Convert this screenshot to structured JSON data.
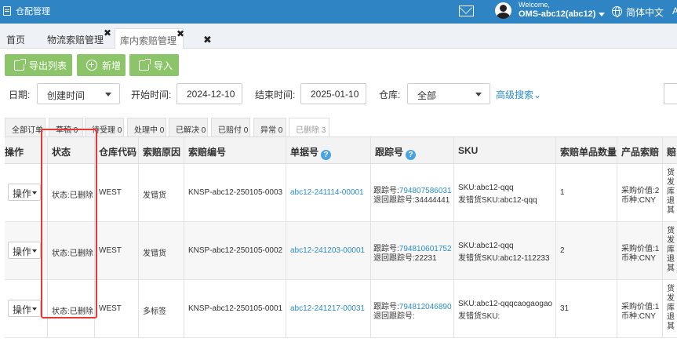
{
  "app": {
    "title": "仓配管理"
  },
  "header": {
    "welcome": "Welcome,",
    "user": "OMS-abc12(abc12)",
    "language": "简体中文",
    "extra": "A"
  },
  "tabs": [
    {
      "label": "首页"
    },
    {
      "label": "物流索赔管理",
      "close": "✖"
    },
    {
      "label": "库内索赔管理",
      "close": "✖"
    },
    {
      "label": "✖"
    }
  ],
  "toolbar": {
    "export": "导出列表",
    "add": "新增",
    "import": "导入"
  },
  "filters": {
    "date_label": "日期:",
    "date_type": "创建时间",
    "start_label": "开始时间:",
    "start_value": "2024-12-10",
    "end_label": "结束时间:",
    "end_value": "2025-01-10",
    "warehouse_label": "仓库:",
    "warehouse_value": "全部",
    "advanced": "高级搜索"
  },
  "status_tabs": [
    {
      "label": "全部订单"
    },
    {
      "label": "草稿 0"
    },
    {
      "label": "待受理 0"
    },
    {
      "label": "处理中 0"
    },
    {
      "label": "已解决 0"
    },
    {
      "label": "已赔付 0"
    },
    {
      "label": "异常 0"
    },
    {
      "label": "已删除 3"
    }
  ],
  "table": {
    "headers": {
      "op": "操作",
      "status": "状态",
      "wh": "仓库代码",
      "reason": "索赔原因",
      "claim_no": "索赔编号",
      "doc_no": "单据号",
      "tracking": "跟踪号",
      "sku": "SKU",
      "qty": "索赔单品数量",
      "product_claim": "产品索赔",
      "last": "赔"
    },
    "rows": [
      {
        "op": "操作",
        "status": "状态:已删除",
        "wh": "WEST",
        "reason": "发错货",
        "claim_no": "KNSP-abc12-250105-0003",
        "doc_no": "abc12-241114-00001",
        "track_label": "跟踪号:",
        "track_no": "794807586031",
        "return_track": "退回跟踪号:34444441",
        "sku1": "SKU:abc12-qqq",
        "sku2": "发错货SKU:abc12-qqq",
        "qty": "1",
        "pc1": "采购价值:2",
        "pc2": "币种:CNY",
        "last": "货发库退其"
      },
      {
        "op": "操作",
        "status": "状态:已删除",
        "wh": "WEST",
        "reason": "发错货",
        "claim_no": "KNSP-abc12-250105-0002",
        "doc_no": "abc12-241203-00001",
        "track_label": "跟踪号:",
        "track_no": "794810601752",
        "return_track": "退回跟踪号:22231",
        "sku1": "SKU:abc12-qqq",
        "sku2": "发错货SKU:abc12-112233",
        "qty": "2",
        "pc1": "采购价值:1",
        "pc2": "币种:CNY",
        "last": "货发库退其"
      },
      {
        "op": "操作",
        "status": "状态:已删除",
        "wh": "WEST",
        "reason": "多标签",
        "claim_no": "KNSP-abc12-250105-0001",
        "doc_no": "abc12-241217-00031",
        "track_label": "跟踪号:",
        "track_no": "794812046890",
        "return_track": "退回跟踪号:",
        "sku1": "SKU:abc12-qqqcaogaogao",
        "sku2": "发错货SKU:",
        "qty": "31",
        "pc1": "采购价值:1",
        "pc2": "币种:CNY",
        "last": "货发库退其"
      }
    ]
  },
  "colors": {
    "topbar": "#2f84c4",
    "button": "#8cc569",
    "link": "#2b8ec7",
    "highlight": "#e53935"
  }
}
